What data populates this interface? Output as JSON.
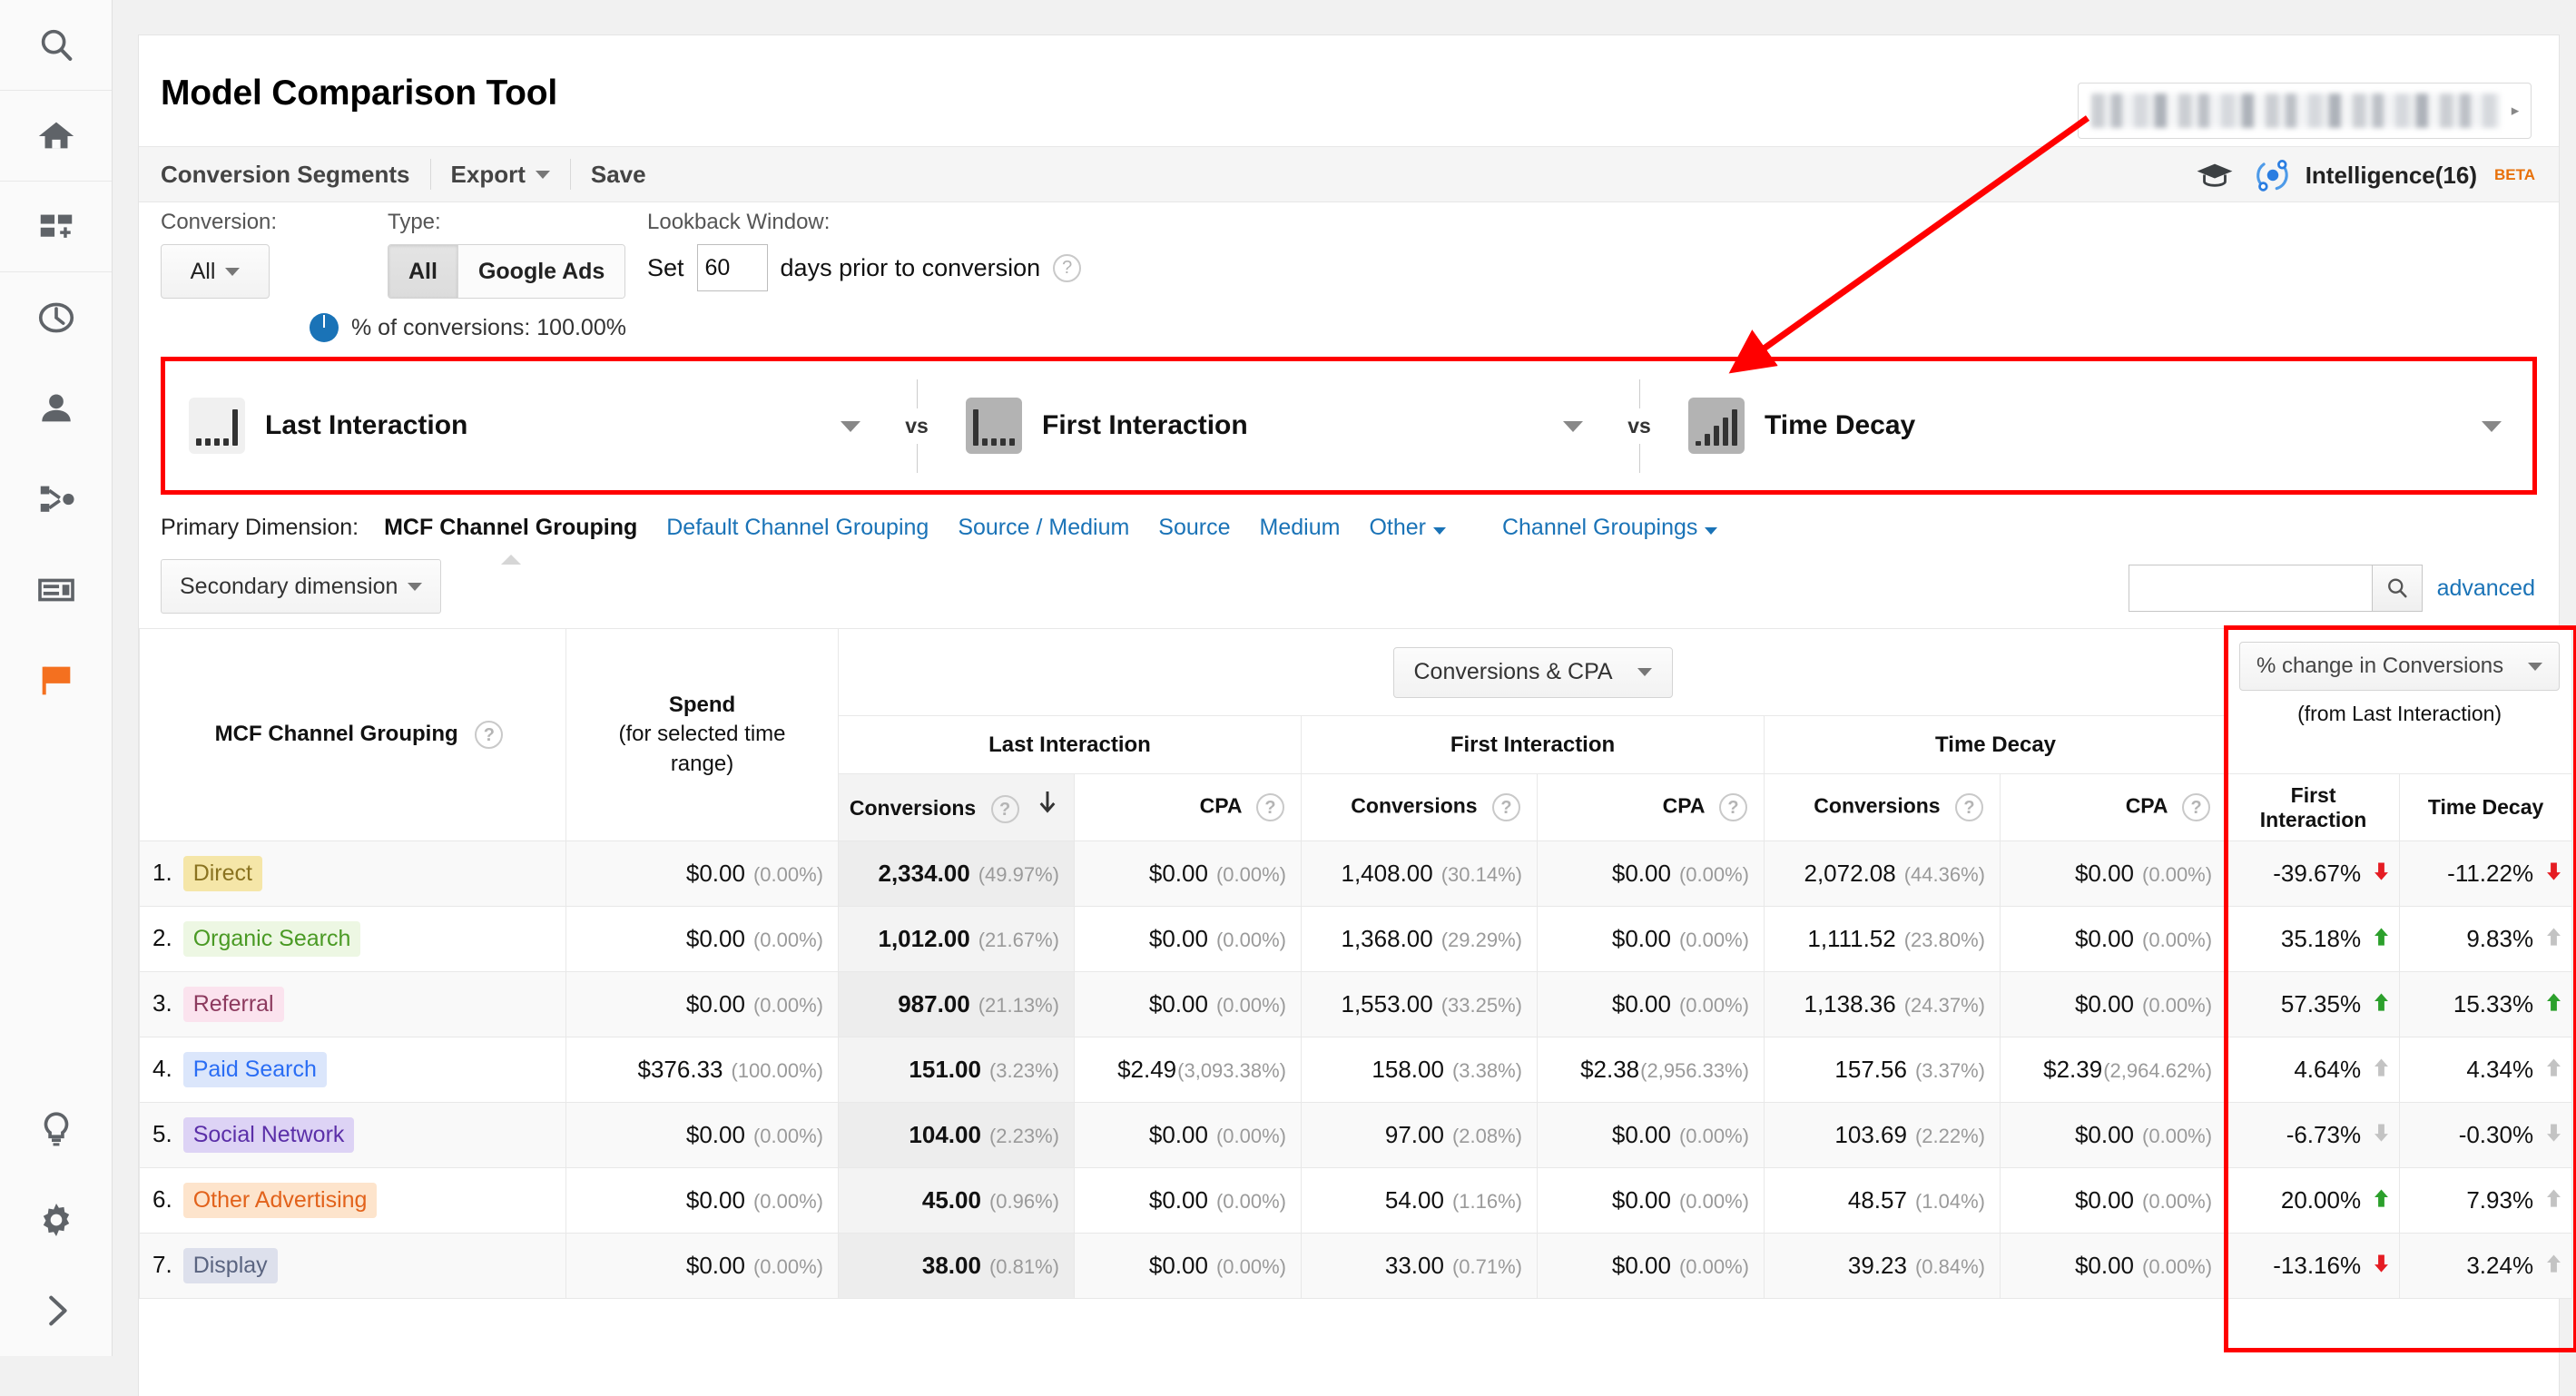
{
  "sidebar": {
    "items": [
      {
        "name": "search-icon",
        "label": "Search"
      },
      {
        "name": "home-icon",
        "label": "Home"
      },
      {
        "name": "customization-icon",
        "label": "Customization"
      },
      {
        "name": "realtime-clock-icon",
        "label": "Realtime"
      },
      {
        "name": "audience-person-icon",
        "label": "Audience"
      },
      {
        "name": "acquisition-share-icon",
        "label": "Acquisition"
      },
      {
        "name": "behavior-card-icon",
        "label": "Behavior"
      },
      {
        "name": "conversions-flag-icon",
        "label": "Conversions"
      }
    ],
    "bottom": [
      {
        "name": "discover-bulb-icon",
        "label": "Discover"
      },
      {
        "name": "admin-gear-icon",
        "label": "Admin"
      },
      {
        "name": "expand-chevron-right-icon",
        "label": "Expand"
      }
    ]
  },
  "header": {
    "title": "Model Comparison Tool",
    "account_selector_caret": "▸"
  },
  "menubar": {
    "items": [
      {
        "label": "Conversion Segments",
        "has_caret": false
      },
      {
        "label": "Export",
        "has_caret": true
      },
      {
        "label": "Save",
        "has_caret": false
      }
    ],
    "intelligence_label": "Intelligence(16)",
    "intelligence_badge": "BETA"
  },
  "controls": {
    "conversion_label": "Conversion:",
    "conversion_value": "All",
    "type_label": "Type:",
    "type_options": [
      "All",
      "Google Ads"
    ],
    "type_selected": "All",
    "lookback_label": "Lookback Window:",
    "lookback_prefix": "Set",
    "lookback_days": "60",
    "lookback_suffix": "days prior to conversion",
    "help_glyph": "?",
    "pct_conversions": "% of conversions: 100.00%"
  },
  "models": {
    "vs_label": "vs",
    "items": [
      {
        "name": "Last Interaction",
        "icon": "bars-last-interaction",
        "icon_style": "light",
        "bars": [
          14,
          14,
          14,
          14,
          46
        ]
      },
      {
        "name": "First Interaction",
        "icon": "bars-first-interaction",
        "icon_style": "dark",
        "bars": [
          46,
          14,
          14,
          14,
          14
        ]
      },
      {
        "name": "Time Decay",
        "icon": "bars-time-decay",
        "icon_style": "dark",
        "bars": [
          8,
          16,
          26,
          34,
          44
        ]
      }
    ]
  },
  "primary_dimension": {
    "label": "Primary Dimension:",
    "active": "MCF Channel Grouping",
    "links": [
      {
        "label": "Default Channel Grouping",
        "caret": false
      },
      {
        "label": "Source / Medium",
        "caret": false
      },
      {
        "label": "Source",
        "caret": false
      },
      {
        "label": "Medium",
        "caret": false
      },
      {
        "label": "Other",
        "caret": true
      },
      {
        "label": "Channel Groupings",
        "caret": true
      }
    ]
  },
  "toolbar2": {
    "secondary_dimension": "Secondary dimension",
    "search_value": "",
    "search_placeholder": "",
    "advanced": "advanced",
    "search_icon": "magnifier-icon"
  },
  "table": {
    "dimension_header": "MCF Channel Grouping",
    "spend_header_line1": "Spend",
    "spend_header_line2": "(for selected time",
    "spend_header_line3": "range)",
    "metric_selector": "Conversions & CPA",
    "pct_selector": "% change in Conversions",
    "pct_from": "(from Last Interaction)",
    "model_groups": [
      "Last Interaction",
      "First Interaction",
      "Time Decay"
    ],
    "sub_headers": [
      "Conversions",
      "CPA"
    ],
    "pct_sub_headers": [
      "First\nInteraction",
      "Time Decay"
    ],
    "rows": [
      {
        "index": "1.",
        "channel": "Direct",
        "chip_bg": "#f5e6a8",
        "chip_fg": "#8a7320",
        "spend": "$0.00",
        "spend_pct": "(0.00%)",
        "li_conv": "2,334.00",
        "li_conv_pct": "(49.97%)",
        "li_cpa": "$0.00",
        "li_cpa_pct": "(0.00%)",
        "fi_conv": "1,408.00",
        "fi_conv_pct": "(30.14%)",
        "fi_cpa": "$0.00",
        "fi_cpa_pct": "(0.00%)",
        "td_conv": "2,072.08",
        "td_conv_pct": "(44.36%)",
        "td_cpa": "$0.00",
        "td_cpa_pct": "(0.00%)",
        "chg_fi": "-39.67%",
        "chg_fi_dir": "down-strong",
        "chg_td": "-11.22%",
        "chg_td_dir": "down-strong"
      },
      {
        "index": "2.",
        "channel": "Organic Search",
        "chip_bg": "#edf7e3",
        "chip_fg": "#4a9a24",
        "spend": "$0.00",
        "spend_pct": "(0.00%)",
        "li_conv": "1,012.00",
        "li_conv_pct": "(21.67%)",
        "li_cpa": "$0.00",
        "li_cpa_pct": "(0.00%)",
        "fi_conv": "1,368.00",
        "fi_conv_pct": "(29.29%)",
        "fi_cpa": "$0.00",
        "fi_cpa_pct": "(0.00%)",
        "td_conv": "1,111.52",
        "td_conv_pct": "(23.80%)",
        "td_cpa": "$0.00",
        "td_cpa_pct": "(0.00%)",
        "chg_fi": "35.18%",
        "chg_fi_dir": "up-strong",
        "chg_td": "9.83%",
        "chg_td_dir": "up-weak"
      },
      {
        "index": "3.",
        "channel": "Referral",
        "chip_bg": "#fbe3ee",
        "chip_fg": "#8c3a5e",
        "spend": "$0.00",
        "spend_pct": "(0.00%)",
        "li_conv": "987.00",
        "li_conv_pct": "(21.13%)",
        "li_cpa": "$0.00",
        "li_cpa_pct": "(0.00%)",
        "fi_conv": "1,553.00",
        "fi_conv_pct": "(33.25%)",
        "fi_cpa": "$0.00",
        "fi_cpa_pct": "(0.00%)",
        "td_conv": "1,138.36",
        "td_conv_pct": "(24.37%)",
        "td_cpa": "$0.00",
        "td_cpa_pct": "(0.00%)",
        "chg_fi": "57.35%",
        "chg_fi_dir": "up-strong",
        "chg_td": "15.33%",
        "chg_td_dir": "up-strong"
      },
      {
        "index": "4.",
        "channel": "Paid Search",
        "chip_bg": "#dbe6fb",
        "chip_fg": "#2a6df4",
        "spend": "$376.33",
        "spend_pct": "(100.00%)",
        "li_conv": "151.00",
        "li_conv_pct": "(3.23%)",
        "li_cpa": "$2.49",
        "li_cpa_pct": "(3,093.38%)",
        "fi_conv": "158.00",
        "fi_conv_pct": "(3.38%)",
        "fi_cpa": "$2.38",
        "fi_cpa_pct": "(2,956.33%)",
        "td_conv": "157.56",
        "td_conv_pct": "(3.37%)",
        "td_cpa": "$2.39",
        "td_cpa_pct": "(2,964.62%)",
        "chg_fi": "4.64%",
        "chg_fi_dir": "up-weak",
        "chg_td": "4.34%",
        "chg_td_dir": "up-weak"
      },
      {
        "index": "5.",
        "channel": "Social Network",
        "chip_bg": "#ddd3f5",
        "chip_fg": "#5b2fa8",
        "spend": "$0.00",
        "spend_pct": "(0.00%)",
        "li_conv": "104.00",
        "li_conv_pct": "(2.23%)",
        "li_cpa": "$0.00",
        "li_cpa_pct": "(0.00%)",
        "fi_conv": "97.00",
        "fi_conv_pct": "(2.08%)",
        "fi_cpa": "$0.00",
        "fi_cpa_pct": "(0.00%)",
        "td_conv": "103.69",
        "td_conv_pct": "(2.22%)",
        "td_cpa": "$0.00",
        "td_cpa_pct": "(0.00%)",
        "chg_fi": "-6.73%",
        "chg_fi_dir": "down-weak",
        "chg_td": "-0.30%",
        "chg_td_dir": "down-weak"
      },
      {
        "index": "6.",
        "channel": "Other Advertising",
        "chip_bg": "#fde4cc",
        "chip_fg": "#e2621b",
        "spend": "$0.00",
        "spend_pct": "(0.00%)",
        "li_conv": "45.00",
        "li_conv_pct": "(0.96%)",
        "li_cpa": "$0.00",
        "li_cpa_pct": "(0.00%)",
        "fi_conv": "54.00",
        "fi_conv_pct": "(1.16%)",
        "fi_cpa": "$0.00",
        "fi_cpa_pct": "(0.00%)",
        "td_conv": "48.57",
        "td_conv_pct": "(1.04%)",
        "td_cpa": "$0.00",
        "td_cpa_pct": "(0.00%)",
        "chg_fi": "20.00%",
        "chg_fi_dir": "up-strong",
        "chg_td": "7.93%",
        "chg_td_dir": "up-weak"
      },
      {
        "index": "7.",
        "channel": "Display",
        "chip_bg": "#dde0ec",
        "chip_fg": "#5a6480",
        "spend": "$0.00",
        "spend_pct": "(0.00%)",
        "li_conv": "38.00",
        "li_conv_pct": "(0.81%)",
        "li_cpa": "$0.00",
        "li_cpa_pct": "(0.00%)",
        "fi_conv": "33.00",
        "fi_conv_pct": "(0.71%)",
        "fi_cpa": "$0.00",
        "fi_cpa_pct": "(0.00%)",
        "td_conv": "39.23",
        "td_conv_pct": "(0.84%)",
        "td_cpa": "$0.00",
        "td_cpa_pct": "(0.00%)",
        "chg_fi": "-13.16%",
        "chg_fi_dir": "down-strong",
        "chg_td": "3.24%",
        "chg_td_dir": "up-weak"
      }
    ]
  },
  "annotations": {
    "arrow_color": "#ff0000",
    "highlight_color": "#ff0000"
  }
}
